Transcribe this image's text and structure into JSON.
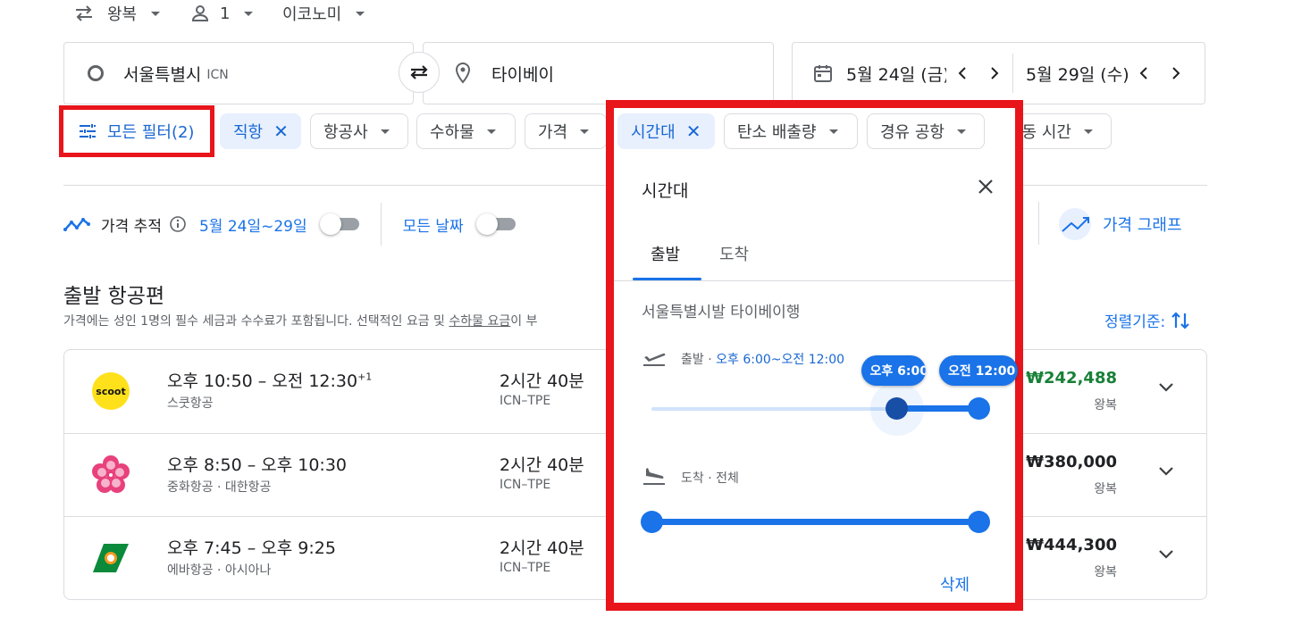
{
  "trip": {
    "type": "왕복",
    "passengers": "1",
    "cabin": "이코노미"
  },
  "search": {
    "origin": "서울특별시",
    "origin_code": "ICN",
    "destination": "타이베이",
    "depart_date": "5월 24일 (금)",
    "return_date": "5월 29일 (수)"
  },
  "filters": {
    "all_filters": "모든 필터(2)",
    "chips": {
      "nonstop": "직항",
      "airline": "항공사",
      "bags": "수하물",
      "price": "가격",
      "times": "시간대",
      "emissions": "탄소 배출량",
      "connecting": "경유 공항",
      "duration": "이동 시간"
    }
  },
  "tracking": {
    "label": "가격 추적",
    "dates": "5월 24일~29일",
    "any_dates": "모든 날짜",
    "price_graph": "가격 그래프"
  },
  "results": {
    "heading": "출발 항공편",
    "note": "가격에는 성인 1명의 필수 세금과 수수료가 포함됩니다. 선택적인 요금 및 ",
    "note_link": "수하물 요금",
    "note_tail": "이 부",
    "sort": "정렬기준:",
    "flights": [
      {
        "time": "오후 10:50 – 오전 12:30",
        "plus": "+1",
        "airline": "스쿳항공",
        "duration": "2시간 40분",
        "route": "ICN–TPE",
        "price": "₩242,488",
        "price_color": "#188038",
        "ptype": "왕복",
        "logo": "scoot-logo"
      },
      {
        "time": "오후 8:50 – 오후 10:30",
        "plus": "",
        "airline": "중화항공 · 대한항공",
        "duration": "2시간 40분",
        "route": "ICN–TPE",
        "price": "₩380,000",
        "price_color": "#202124",
        "ptype": "왕복",
        "logo": "plum-blossom-logo"
      },
      {
        "time": "오후 7:45 – 오후 9:25",
        "plus": "",
        "airline": "에바항공 · 아시아나",
        "duration": "2시간 40분",
        "route": "ICN–TPE",
        "price": "₩444,300",
        "price_color": "#202124",
        "ptype": "왕복",
        "logo": "eva-logo"
      }
    ]
  },
  "panel": {
    "title": "시간대",
    "tabs": [
      "출발",
      "도착"
    ],
    "subtitle": "서울특별시발 타이베이행",
    "depart_label": "출발 · ",
    "depart_value": "오후 6:00~오전 12:00",
    "depart_min_bubble": "오후 6:00",
    "depart_max_bubble": "오전 12:00",
    "depart_range": [
      0.75,
      1.0
    ],
    "arrive_label": "도착 · 전체",
    "arrive_range": [
      0.0,
      1.0
    ],
    "delete": "삭제"
  },
  "colors": {
    "accent": "#1a73e8",
    "highlight": "#e8151b"
  }
}
